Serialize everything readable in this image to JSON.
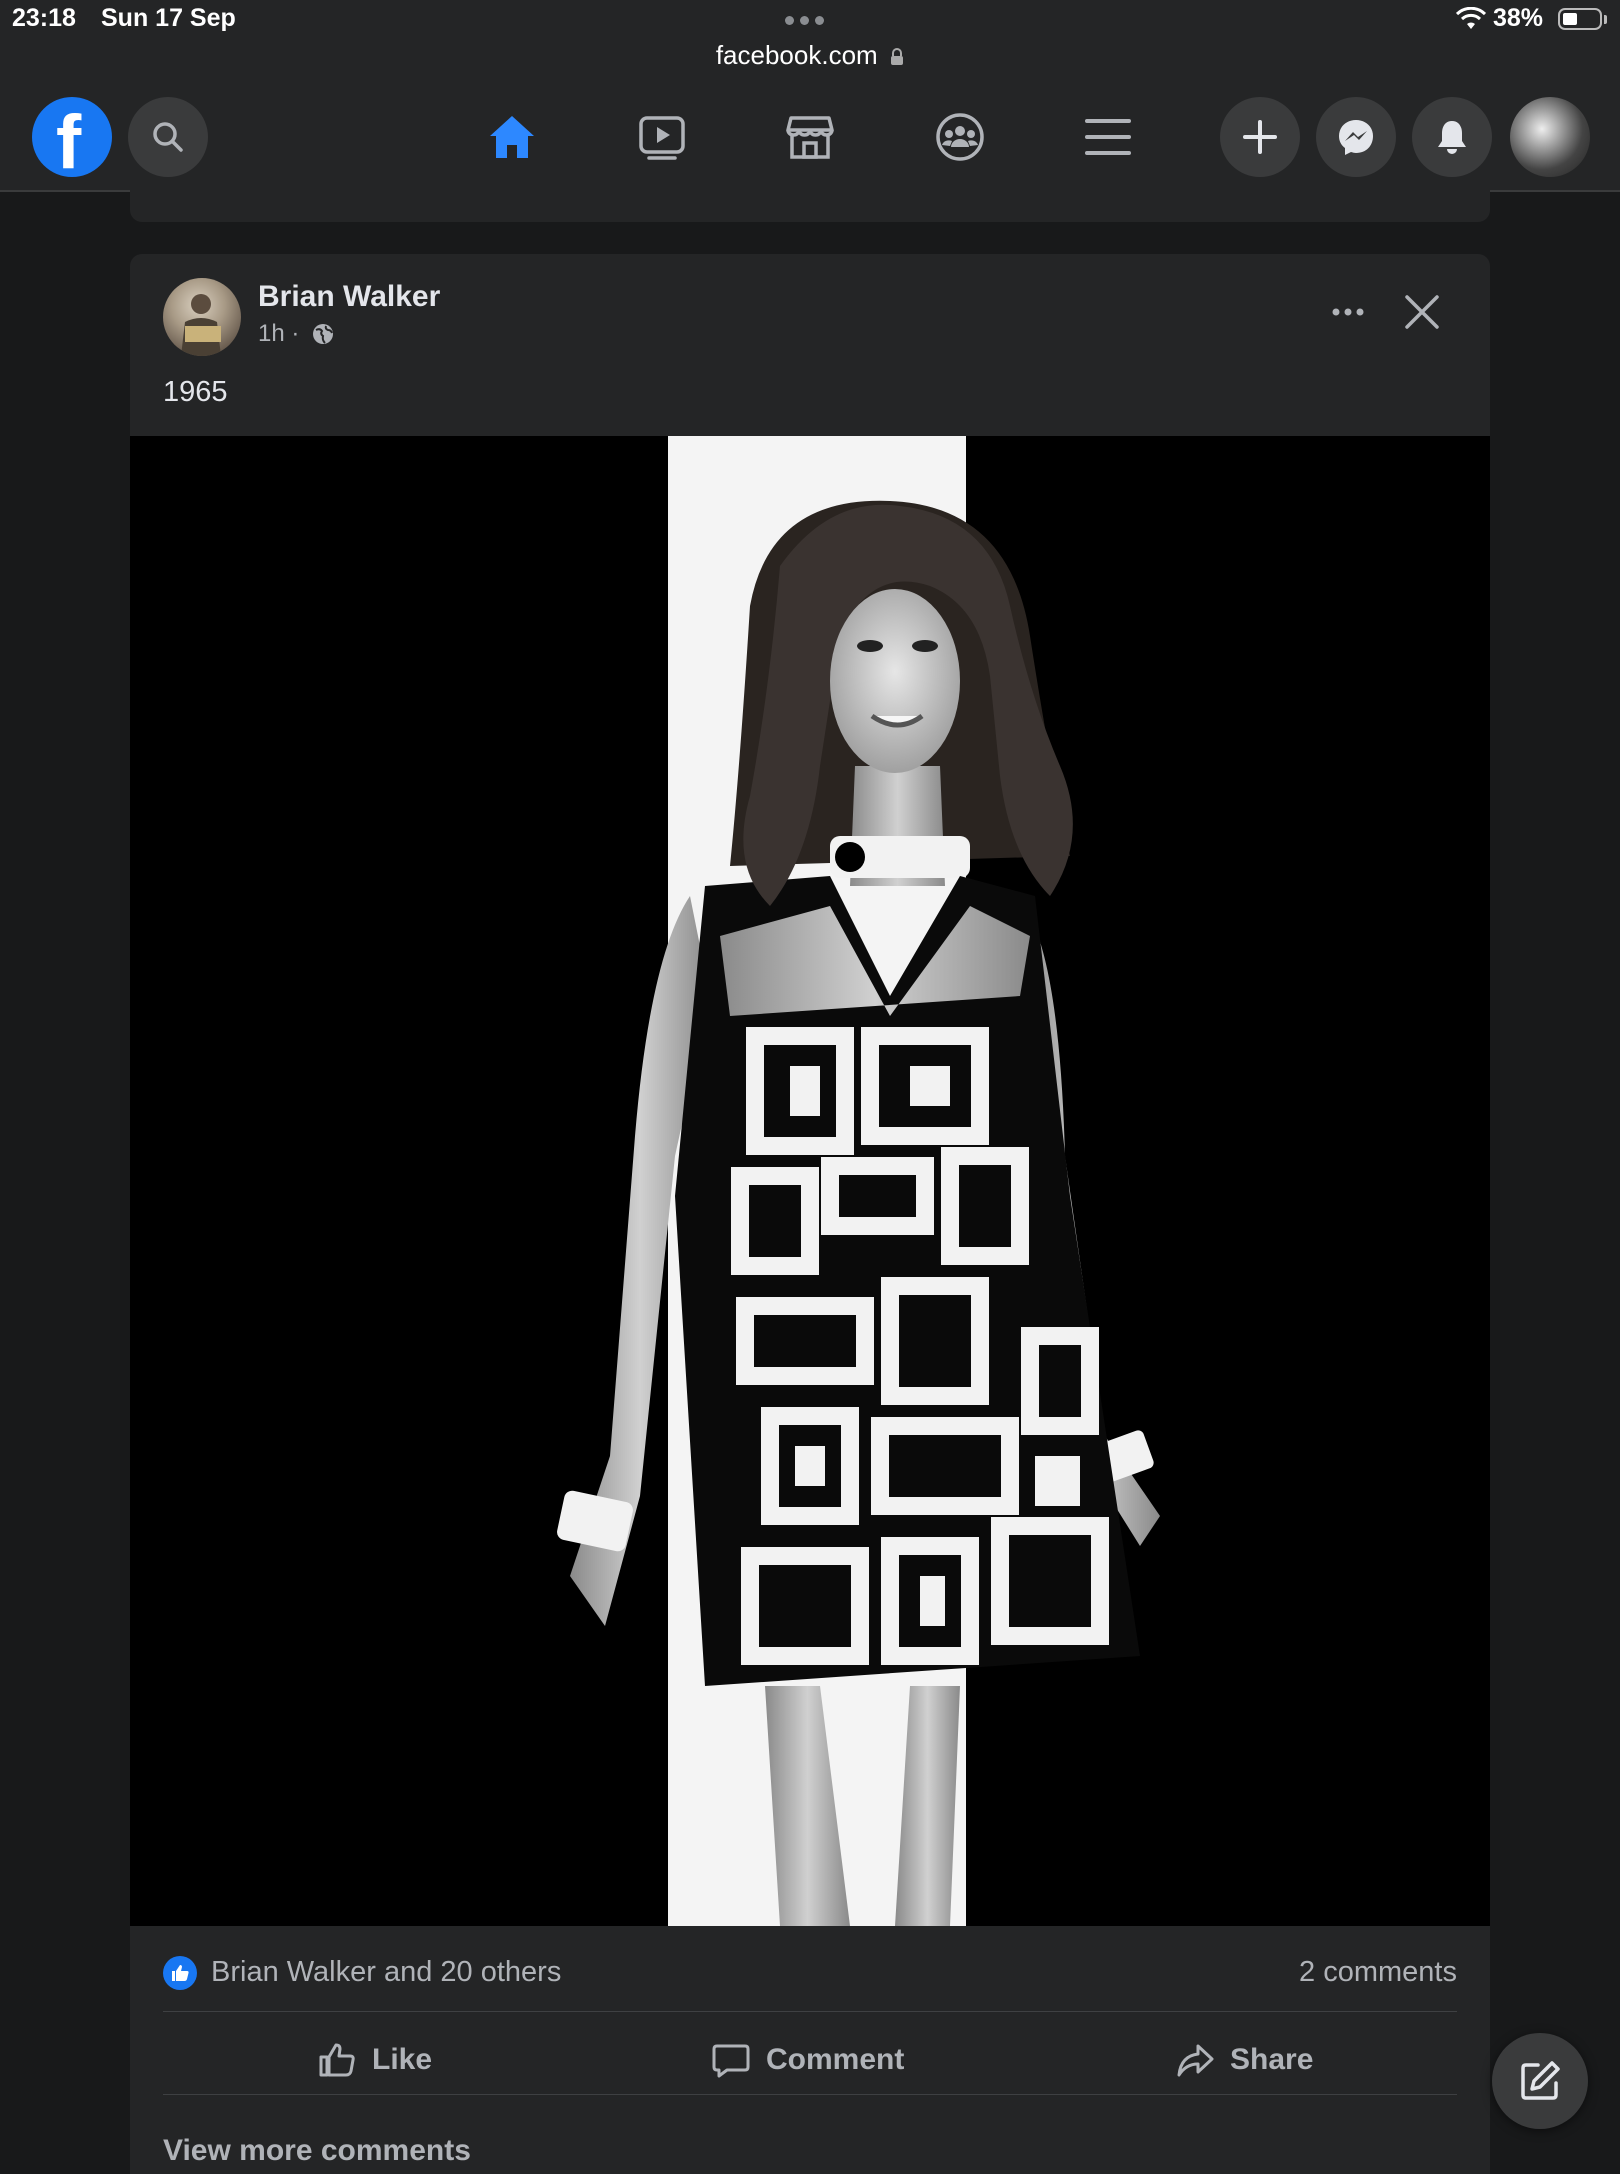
{
  "status_bar": {
    "time": "23:18",
    "date": "Sun 17 Sep",
    "battery": "38%"
  },
  "browser": {
    "url": "facebook.com"
  },
  "navbar": {
    "logo_letter": "f",
    "tabs": [
      "home",
      "watch",
      "marketplace",
      "groups",
      "menu"
    ],
    "active_tab": "home",
    "accent_color": "#2d88ff"
  },
  "post": {
    "author": "Brian Walker",
    "time": "1h",
    "separator": "·",
    "text": "1965",
    "reactions": "Brian Walker and 20 others",
    "comments_count": "2 comments",
    "actions": {
      "like": "Like",
      "comment": "Comment",
      "share": "Share"
    },
    "view_more": "View more comments"
  },
  "colors": {
    "background": "#18191a",
    "surface": "#242526",
    "brand": "#1877f2"
  }
}
